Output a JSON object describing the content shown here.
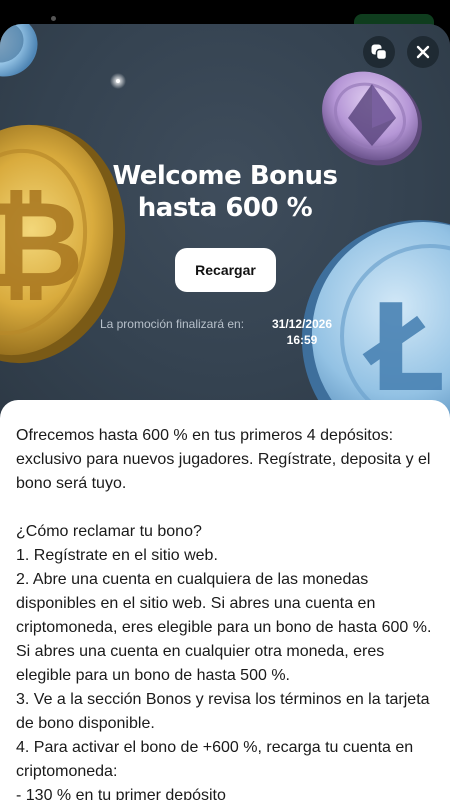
{
  "promo": {
    "title": "Welcome Bonus\nhasta 600 %",
    "button_label": "Recargar",
    "end_label": "La promoción finalizará en:",
    "end_date": "31/12/2026\n16:59"
  },
  "header": {
    "copy_icon": "copy-icon",
    "close_icon": "close-icon"
  },
  "body_text": "Ofrecemos hasta 600 % en tus primeros 4 depósitos: exclusivo para nuevos jugadores. Regístrate, deposita y el bono será tuyo.\n\n¿Cómo reclamar tu bono?\n1. Regístrate en el sitio web.\n2. Abre una cuenta en cualquiera de las monedas disponibles en el sitio web. Si abres una cuenta en criptomoneda, eres elegible para un bono de hasta 600 %. Si abres una cuenta en cualquier otra moneda, eres elegible para un bono de hasta 500 %.\n3. Ve a la sección Bonos y revisa los términos en la tarjeta de bono disponible.\n4. Para activar el bono de +600 %, recarga tu cuenta en criptomoneda:\n- 130 % en tu primer depósito",
  "colors": {
    "hero_bg": "#354350",
    "bitcoin": "#e0b84a",
    "ethereum": "#b79ad8",
    "litecoin": "#8fc0e6"
  }
}
